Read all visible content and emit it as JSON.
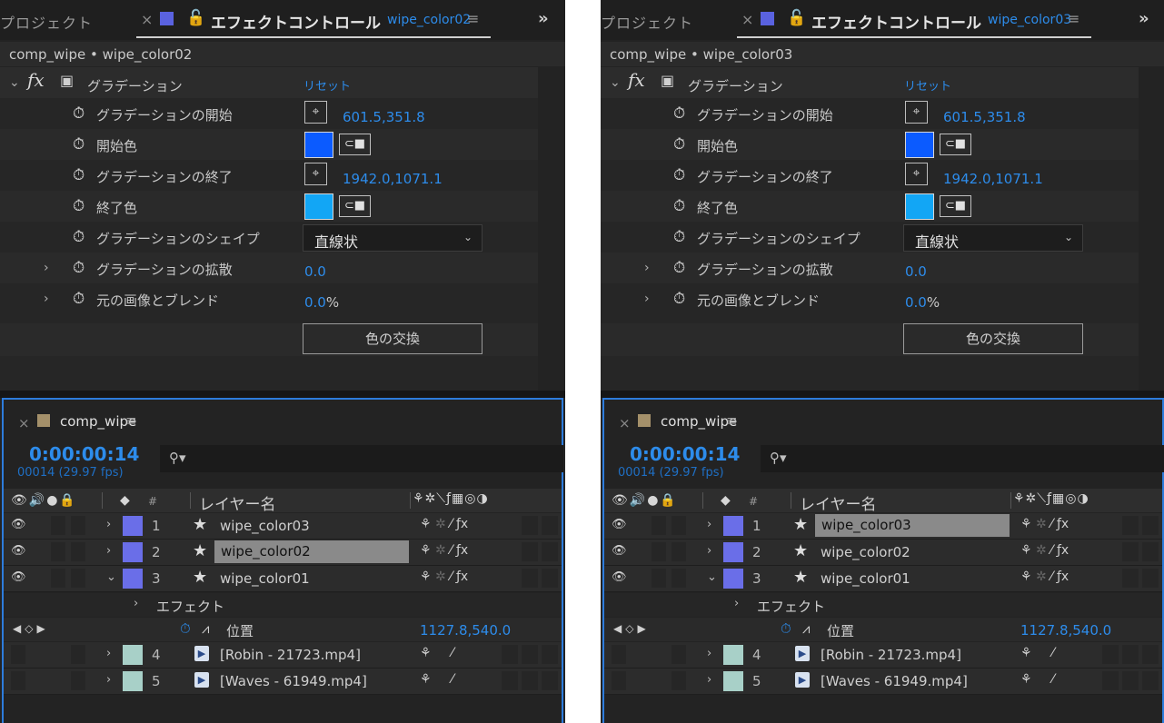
{
  "panels": [
    {
      "id": "left",
      "effect_controls": {
        "tab_project": "プロジェクト",
        "tab_close": "×",
        "lock_icon": "lock-icon",
        "tab_title": "エフェクトコントロール",
        "tab_layer": "wipe_color02",
        "tab_menu": "≡",
        "more": "»",
        "breadcrumb": "comp_wipe • wipe_color02",
        "effect": {
          "fx": "fx",
          "name": "グラデーション",
          "reset": "リセット"
        },
        "params": [
          {
            "name": "グラデーションの開始",
            "value": "601.5,351.8"
          },
          {
            "name": "開始色",
            "color": "#0b5bff"
          },
          {
            "name": "グラデーションの終了",
            "value": "1942.0,1071.1"
          },
          {
            "name": "終了色",
            "color": "#12a6f5"
          },
          {
            "name": "グラデーションのシェイプ",
            "value": "直線状"
          },
          {
            "name": "グラデーションの拡散",
            "value": "0.0"
          },
          {
            "name": "元の画像とブレンド",
            "value": "0.0",
            "unit": "%"
          }
        ],
        "swap_button": "色の交換"
      },
      "timeline": {
        "tab_close": "×",
        "comp_name": "comp_wipe",
        "tab_menu": "≡",
        "timecode": "0:00:00:14",
        "frames": "00014 (29.97 fps)",
        "search_icon": "search-icon",
        "header": {
          "num": "#",
          "layer_name": "レイヤー名"
        },
        "layers": [
          {
            "num": "1",
            "name": "wipe_color03",
            "color": "#6a6ee8",
            "kind": "shape",
            "highlighted": false
          },
          {
            "num": "2",
            "name": "wipe_color02",
            "color": "#6a6ee8",
            "kind": "shape",
            "highlighted": true
          },
          {
            "num": "3",
            "name": "wipe_color01",
            "color": "#6a6ee8",
            "kind": "shape",
            "highlighted": false
          }
        ],
        "sub_effect": "エフェクト",
        "position_label": "位置",
        "position_value": "1127.8,540.0",
        "media_layers": [
          {
            "num": "4",
            "name": "[Robin - 21723.mp4]",
            "color": "#a8d0c8"
          },
          {
            "num": "5",
            "name": "[Waves - 61949.mp4]",
            "color": "#a8d0c8"
          }
        ]
      }
    },
    {
      "id": "right",
      "effect_controls": {
        "tab_project": "プロジェクト",
        "tab_close": "×",
        "lock_icon": "lock-icon",
        "tab_title": "エフェクトコントロール",
        "tab_layer": "wipe_color03",
        "tab_menu": "≡",
        "more": "»",
        "breadcrumb": "comp_wipe • wipe_color03",
        "effect": {
          "fx": "fx",
          "name": "グラデーション",
          "reset": "リセット"
        },
        "params": [
          {
            "name": "グラデーションの開始",
            "value": "601.5,351.8"
          },
          {
            "name": "開始色",
            "color": "#0b5bff"
          },
          {
            "name": "グラデーションの終了",
            "value": "1942.0,1071.1"
          },
          {
            "name": "終了色",
            "color": "#12a6f5"
          },
          {
            "name": "グラデーションのシェイプ",
            "value": "直線状"
          },
          {
            "name": "グラデーションの拡散",
            "value": "0.0"
          },
          {
            "name": "元の画像とブレンド",
            "value": "0.0",
            "unit": "%"
          }
        ],
        "swap_button": "色の交換"
      },
      "timeline": {
        "tab_close": "×",
        "comp_name": "comp_wipe",
        "tab_menu": "≡",
        "timecode": "0:00:00:14",
        "frames": "00014 (29.97 fps)",
        "search_icon": "search-icon",
        "header": {
          "num": "#",
          "layer_name": "レイヤー名"
        },
        "layers": [
          {
            "num": "1",
            "name": "wipe_color03",
            "color": "#6a6ee8",
            "kind": "shape",
            "highlighted": true
          },
          {
            "num": "2",
            "name": "wipe_color02",
            "color": "#6a6ee8",
            "kind": "shape",
            "highlighted": false
          },
          {
            "num": "3",
            "name": "wipe_color01",
            "color": "#6a6ee8",
            "kind": "shape",
            "highlighted": false
          }
        ],
        "sub_effect": "エフェクト",
        "position_label": "位置",
        "position_value": "1127.8,540.0",
        "media_layers": [
          {
            "num": "4",
            "name": "[Robin - 21723.mp4]",
            "color": "#a8d0c8"
          },
          {
            "num": "5",
            "name": "[Waves - 61949.mp4]",
            "color": "#a8d0c8"
          }
        ]
      }
    }
  ]
}
